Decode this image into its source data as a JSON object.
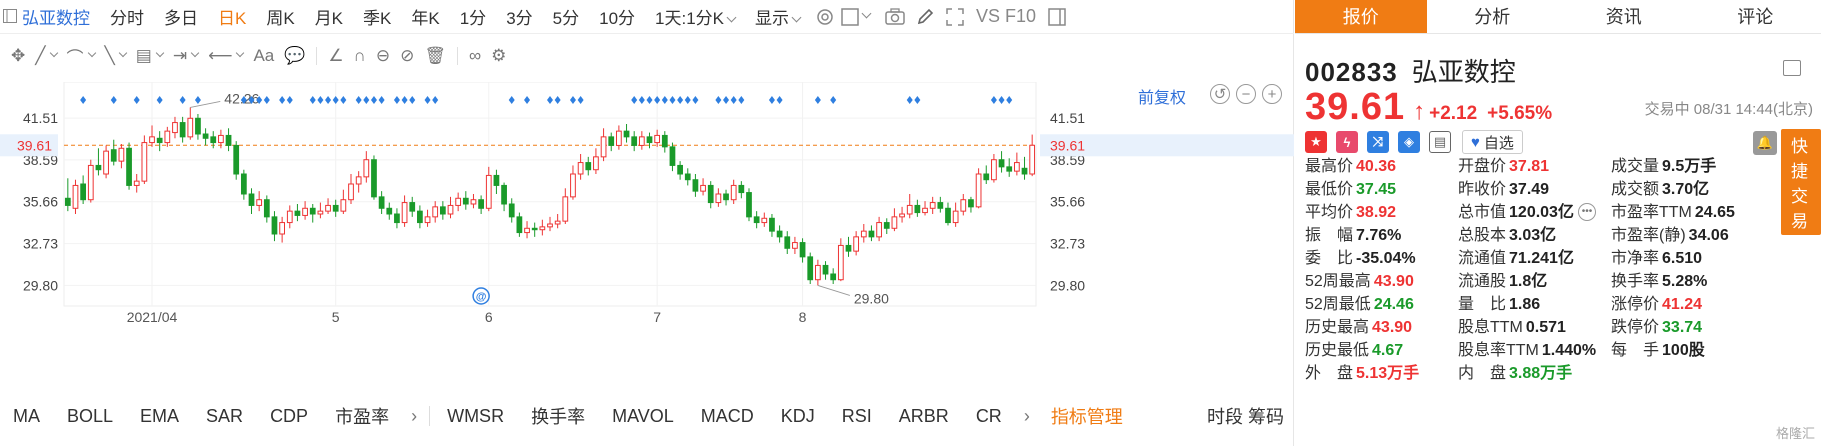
{
  "header": {
    "stock_name": "弘亚数控",
    "periods": [
      "分时",
      "多日",
      "日K",
      "周K",
      "月K",
      "季K",
      "年K",
      "1分",
      "3分",
      "5分",
      "10分"
    ],
    "active_period": "日K",
    "custom_period": "1天:1分K",
    "display_label": "显示",
    "vs_f10": "VS F10"
  },
  "chart": {
    "fq_label": "前复权",
    "y_ticks": [
      "41.51",
      "38.59",
      "35.66",
      "32.73",
      "29.80"
    ],
    "current_price_tag": "39.61",
    "x_ticks": [
      "2021/04",
      "5",
      "6",
      "7",
      "8"
    ],
    "high_label": "42.26",
    "low_label": "29.80",
    "event_marker": "@"
  },
  "chart_data": {
    "type": "candlestick",
    "x_tick_labels": [
      "2021/04",
      "5",
      "6",
      "7",
      "8"
    ],
    "ylim": [
      28.5,
      43.2
    ],
    "y_ticks": [
      29.8,
      32.73,
      35.66,
      38.59,
      41.51
    ],
    "reference_line": 39.61,
    "max_marker": 42.26,
    "min_marker": 29.8,
    "candles": [
      [
        35.9,
        35.4,
        37.3,
        35.0
      ],
      [
        35.2,
        36.8,
        37.2,
        34.8
      ],
      [
        36.9,
        35.8,
        37.5,
        35.5
      ],
      [
        35.8,
        38.2,
        38.6,
        35.6
      ],
      [
        38.2,
        37.9,
        39.4,
        37.5
      ],
      [
        37.6,
        39.2,
        39.6,
        37.3
      ],
      [
        39.3,
        38.5,
        40.0,
        38.2
      ],
      [
        38.5,
        39.4,
        39.7,
        38.0
      ],
      [
        39.4,
        36.8,
        39.8,
        36.5
      ],
      [
        36.8,
        37.1,
        37.6,
        36.3
      ],
      [
        37.1,
        39.8,
        40.3,
        36.9
      ],
      [
        39.8,
        40.2,
        41.0,
        39.5
      ],
      [
        40.1,
        39.8,
        40.6,
        39.2
      ],
      [
        39.8,
        40.6,
        40.9,
        39.5
      ],
      [
        40.5,
        41.2,
        41.6,
        40.1
      ],
      [
        41.2,
        40.2,
        41.6,
        39.8
      ],
      [
        40.2,
        41.5,
        42.26,
        40.0
      ],
      [
        41.5,
        40.4,
        41.8,
        40.0
      ],
      [
        40.4,
        40.1,
        40.8,
        39.6
      ],
      [
        40.2,
        39.8,
        40.6,
        39.4
      ],
      [
        39.8,
        40.3,
        40.7,
        39.4
      ],
      [
        40.3,
        39.6,
        40.8,
        39.2
      ],
      [
        39.6,
        37.6,
        39.9,
        37.2
      ],
      [
        37.6,
        36.2,
        37.9,
        35.8
      ],
      [
        36.2,
        35.4,
        36.6,
        34.8
      ],
      [
        35.4,
        35.8,
        36.4,
        35.0
      ],
      [
        35.8,
        34.6,
        36.1,
        34.2
      ],
      [
        34.6,
        33.4,
        35.0,
        32.9
      ],
      [
        33.4,
        34.2,
        34.6,
        32.8
      ],
      [
        34.2,
        35.0,
        35.4,
        33.8
      ],
      [
        35.0,
        34.7,
        35.5,
        34.3
      ],
      [
        34.7,
        35.2,
        35.7,
        34.4
      ],
      [
        35.2,
        34.8,
        35.5,
        34.2
      ],
      [
        34.8,
        35.0,
        35.6,
        34.5
      ],
      [
        35.0,
        35.4,
        35.9,
        34.8
      ],
      [
        35.4,
        35.0,
        35.8,
        34.6
      ],
      [
        35.0,
        35.8,
        36.5,
        34.8
      ],
      [
        35.8,
        36.9,
        37.6,
        35.5
      ],
      [
        36.9,
        37.4,
        37.8,
        36.3
      ],
      [
        37.4,
        38.6,
        39.2,
        37.0
      ],
      [
        38.6,
        36.0,
        38.9,
        35.8
      ],
      [
        36.0,
        35.2,
        36.4,
        34.8
      ],
      [
        35.2,
        34.8,
        35.6,
        34.4
      ],
      [
        34.8,
        34.2,
        35.2,
        33.8
      ],
      [
        34.2,
        35.6,
        36.1,
        33.9
      ],
      [
        35.6,
        35.0,
        36.0,
        34.6
      ],
      [
        35.0,
        34.2,
        35.4,
        33.8
      ],
      [
        34.2,
        34.6,
        35.1,
        33.9
      ],
      [
        34.6,
        35.3,
        35.7,
        34.2
      ],
      [
        35.3,
        34.8,
        35.7,
        34.4
      ],
      [
        34.8,
        35.4,
        36.0,
        34.5
      ],
      [
        35.4,
        35.9,
        36.3,
        35.0
      ],
      [
        35.9,
        35.5,
        36.4,
        35.1
      ],
      [
        35.5,
        35.8,
        36.2,
        35.2
      ],
      [
        35.8,
        35.2,
        36.1,
        34.8
      ],
      [
        35.2,
        37.5,
        38.1,
        35.0
      ],
      [
        37.5,
        36.8,
        37.9,
        36.2
      ],
      [
        36.8,
        35.5,
        37.0,
        35.0
      ],
      [
        35.5,
        34.6,
        35.9,
        34.2
      ],
      [
        34.6,
        33.5,
        34.9,
        33.2
      ],
      [
        33.5,
        33.8,
        34.3,
        33.1
      ],
      [
        33.8,
        33.7,
        34.2,
        33.2
      ],
      [
        33.7,
        33.9,
        34.4,
        33.3
      ],
      [
        33.9,
        34.1,
        34.6,
        33.6
      ],
      [
        34.1,
        34.3,
        34.8,
        33.8
      ],
      [
        34.3,
        36.0,
        36.6,
        34.1
      ],
      [
        36.0,
        37.6,
        38.2,
        35.8
      ],
      [
        37.6,
        38.4,
        39.0,
        37.2
      ],
      [
        38.4,
        37.9,
        38.8,
        37.5
      ],
      [
        37.9,
        38.8,
        39.4,
        37.6
      ],
      [
        38.8,
        40.2,
        40.8,
        38.5
      ],
      [
        40.2,
        39.6,
        40.5,
        39.2
      ],
      [
        39.6,
        40.6,
        41.0,
        39.3
      ],
      [
        40.6,
        40.2,
        41.1,
        39.8
      ],
      [
        40.2,
        39.6,
        40.6,
        39.2
      ],
      [
        39.6,
        40.2,
        40.6,
        39.3
      ],
      [
        40.2,
        39.8,
        40.5,
        39.4
      ],
      [
        39.8,
        40.3,
        40.7,
        39.5
      ],
      [
        40.3,
        39.5,
        40.6,
        39.1
      ],
      [
        39.5,
        38.2,
        39.8,
        37.8
      ],
      [
        38.2,
        37.6,
        38.5,
        37.2
      ],
      [
        37.6,
        37.2,
        38.0,
        36.8
      ],
      [
        37.2,
        36.4,
        37.6,
        36.0
      ],
      [
        36.4,
        36.8,
        37.3,
        36.1
      ],
      [
        36.8,
        35.6,
        37.1,
        35.2
      ],
      [
        35.6,
        36.2,
        36.6,
        35.3
      ],
      [
        36.2,
        35.8,
        36.5,
        35.4
      ],
      [
        35.8,
        36.8,
        37.2,
        35.5
      ],
      [
        36.8,
        36.3,
        37.1,
        35.9
      ],
      [
        36.3,
        34.6,
        36.6,
        34.3
      ],
      [
        34.6,
        34.2,
        35.0,
        33.8
      ],
      [
        34.2,
        34.5,
        34.9,
        33.9
      ],
      [
        34.5,
        33.6,
        34.8,
        33.2
      ],
      [
        33.6,
        33.2,
        34.0,
        32.8
      ],
      [
        33.2,
        32.4,
        33.6,
        32.0
      ],
      [
        32.4,
        32.8,
        33.2,
        32.0
      ],
      [
        32.8,
        31.8,
        33.1,
        31.4
      ],
      [
        31.8,
        30.2,
        32.1,
        29.9
      ],
      [
        30.2,
        31.2,
        31.6,
        29.8
      ],
      [
        31.2,
        30.6,
        31.5,
        30.2
      ],
      [
        30.6,
        30.2,
        31.0,
        29.9
      ],
      [
        30.2,
        32.6,
        33.1,
        30.1
      ],
      [
        32.6,
        32.2,
        33.2,
        31.8
      ],
      [
        32.2,
        33.2,
        33.6,
        31.9
      ],
      [
        33.2,
        33.6,
        34.1,
        32.8
      ],
      [
        33.6,
        33.2,
        34.0,
        32.9
      ],
      [
        33.2,
        34.2,
        34.6,
        32.9
      ],
      [
        34.2,
        33.8,
        34.5,
        33.4
      ],
      [
        33.8,
        34.6,
        35.2,
        33.6
      ],
      [
        34.6,
        34.8,
        35.3,
        34.2
      ],
      [
        34.8,
        35.4,
        36.2,
        34.5
      ],
      [
        35.4,
        34.9,
        35.8,
        34.6
      ],
      [
        34.9,
        35.2,
        35.7,
        34.7
      ],
      [
        35.2,
        35.6,
        36.0,
        34.8
      ],
      [
        35.6,
        35.2,
        36.0,
        34.9
      ],
      [
        35.2,
        34.2,
        35.6,
        34.0
      ],
      [
        34.2,
        35.0,
        35.6,
        33.9
      ],
      [
        35.0,
        35.8,
        36.2,
        34.7
      ],
      [
        35.8,
        35.3,
        36.0,
        34.9
      ],
      [
        35.3,
        37.6,
        38.0,
        35.2
      ],
      [
        37.6,
        37.2,
        38.2,
        36.9
      ],
      [
        37.2,
        38.6,
        39.0,
        37.0
      ],
      [
        38.6,
        38.1,
        39.2,
        37.7
      ],
      [
        38.1,
        37.8,
        38.7,
        37.4
      ],
      [
        37.8,
        38.4,
        39.1,
        37.5
      ],
      [
        38.0,
        37.6,
        38.8,
        37.2
      ],
      [
        37.6,
        39.61,
        40.36,
        37.45
      ]
    ],
    "signal_marker_columns": [
      2,
      6,
      9,
      12,
      15,
      17,
      23,
      24,
      25,
      26,
      28,
      29,
      32,
      33,
      34,
      35,
      36,
      38,
      39,
      40,
      41,
      43,
      44,
      45,
      47,
      48,
      58,
      60,
      63,
      64,
      66,
      67,
      74,
      75,
      76,
      77,
      78,
      79,
      80,
      81,
      82,
      85,
      86,
      87,
      88,
      92,
      93,
      98,
      100,
      110,
      111,
      121,
      122,
      123
    ]
  },
  "drawing_tools": [
    "✥",
    "╱",
    "⌒",
    "╲",
    "▤",
    "⇥",
    "⟵",
    "Aa",
    "💬",
    "∠",
    "∩",
    "⊖",
    "⊘",
    "🗑",
    "∞",
    "⚙"
  ],
  "indicators": [
    "MA",
    "BOLL",
    "EMA",
    "SAR",
    "CDP",
    "市盈率",
    "WMSR",
    "换手率",
    "MAVOL",
    "MACD",
    "KDJ",
    "RSI",
    "ARBR",
    "CR"
  ],
  "indicator_manage": "指标管理",
  "indicator_right": "时段 筹码",
  "panel": {
    "tabs": [
      "报价",
      "分析",
      "资讯",
      "评论"
    ],
    "active_tab": "报价",
    "code": "002833",
    "name": "弘亚数控",
    "price": "39.61",
    "change": "+2.12",
    "change_pct": "+5.65%",
    "status": "交易中 08/31 14:44(北京)",
    "watch_label": "自选",
    "quick_trade": "快捷交易",
    "rows": [
      [
        [
          "最高价",
          "40.36",
          "red"
        ],
        [
          "开盘价",
          "37.81",
          "red"
        ],
        [
          "成交量",
          "9.5万手",
          "blk"
        ]
      ],
      [
        [
          "最低价",
          "37.45",
          "green"
        ],
        [
          "昨收价",
          "37.49",
          "blk"
        ],
        [
          "成交额",
          "3.70亿",
          "blk"
        ]
      ],
      [
        [
          "平均价",
          "38.92",
          "red"
        ],
        [
          "总市值",
          "120.03亿",
          "blk"
        ],
        [
          "市盈率TTM",
          "24.65",
          "blk"
        ]
      ],
      [
        [
          "振　幅",
          "7.76%",
          "blk"
        ],
        [
          "总股本",
          "3.03亿",
          "blk"
        ],
        [
          "市盈率(静)",
          "34.06",
          "blk"
        ]
      ],
      [
        [
          "委　比",
          "-35.04%",
          "blk"
        ],
        [
          "流通值",
          "71.241亿",
          "blk"
        ],
        [
          "市净率",
          "6.510",
          "blk"
        ]
      ],
      [
        [
          "52周最高",
          "43.90",
          "red"
        ],
        [
          "流通股",
          "1.8亿",
          "blk"
        ],
        [
          "换手率",
          "5.28%",
          "blk"
        ]
      ],
      [
        [
          "52周最低",
          "24.46",
          "green"
        ],
        [
          "量　比",
          "1.86",
          "blk"
        ],
        [
          "涨停价",
          "41.24",
          "red"
        ]
      ],
      [
        [
          "历史最高",
          "43.90",
          "red"
        ],
        [
          "股息TTM",
          "0.571",
          "blk"
        ],
        [
          "跌停价",
          "33.74",
          "green"
        ]
      ],
      [
        [
          "历史最低",
          "4.67",
          "green"
        ],
        [
          "股息率TTM",
          "1.440%",
          "blk"
        ],
        [
          "每　手",
          "100股",
          "blk"
        ]
      ],
      [
        [
          "外　盘",
          "5.13万手",
          "red"
        ],
        [
          "内　盘",
          "3.88万手",
          "green"
        ],
        [
          "",
          "",
          " "
        ]
      ]
    ],
    "watermark": "格隆汇"
  }
}
